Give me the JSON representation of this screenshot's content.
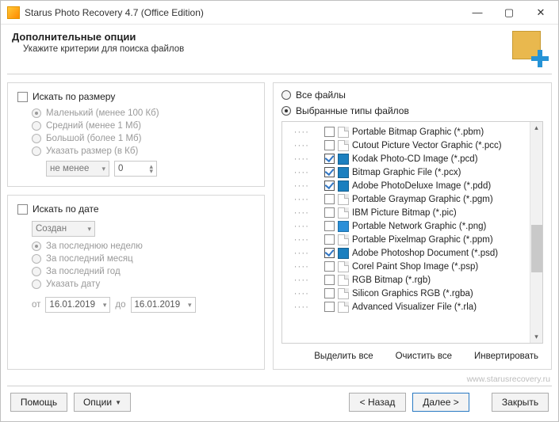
{
  "window": {
    "title": "Starus Photo Recovery 4.7 (Office Edition)"
  },
  "header": {
    "title": "Дополнительные опции",
    "subtitle": "Укажите критерии для поиска файлов"
  },
  "size_panel": {
    "title": "Искать по размеру",
    "opts": [
      "Маленький (менее 100 Кб)",
      "Средний (менее 1 Мб)",
      "Большой (более 1 Мб)",
      "Указать размер (в Кб)"
    ],
    "combo": "не менее",
    "spin": "0"
  },
  "date_panel": {
    "title": "Искать по дате",
    "combo": "Создан",
    "opts": [
      "За последнюю неделю",
      "За последний месяц",
      "За последний год",
      "Указать дату"
    ],
    "from_lbl": "от",
    "to_lbl": "до",
    "from": "16.01.2019",
    "to": "16.01.2019"
  },
  "types_panel": {
    "all_label": "Все файлы",
    "selected_label": "Выбранные типы файлов",
    "items": [
      {
        "checked": false,
        "icon": "doc",
        "label": "Portable Bitmap Graphic (*.pbm)"
      },
      {
        "checked": false,
        "icon": "doc",
        "label": "Cutout Picture Vector Graphic (*.pcc)"
      },
      {
        "checked": true,
        "icon": "ps",
        "label": "Kodak Photo-CD Image (*.pcd)"
      },
      {
        "checked": true,
        "icon": "ps",
        "label": "Bitmap Graphic File (*.pcx)"
      },
      {
        "checked": true,
        "icon": "ps",
        "label": "Adobe PhotoDeluxe Image (*.pdd)"
      },
      {
        "checked": false,
        "icon": "doc",
        "label": "Portable Graymap Graphic (*.pgm)"
      },
      {
        "checked": false,
        "icon": "doc",
        "label": "IBM Picture Bitmap (*.pic)"
      },
      {
        "checked": false,
        "icon": "png",
        "label": "Portable Network Graphic (*.png)"
      },
      {
        "checked": false,
        "icon": "doc",
        "label": "Portable Pixelmap Graphic (*.ppm)"
      },
      {
        "checked": true,
        "icon": "ps",
        "label": "Adobe Photoshop Document (*.psd)"
      },
      {
        "checked": false,
        "icon": "doc",
        "label": "Corel Paint Shop Image (*.psp)"
      },
      {
        "checked": false,
        "icon": "doc",
        "label": "RGB Bitmap (*.rgb)"
      },
      {
        "checked": false,
        "icon": "doc",
        "label": "Silicon Graphics RGB (*.rgba)"
      },
      {
        "checked": false,
        "icon": "doc",
        "label": "Advanced Visualizer File (*.rla)"
      }
    ],
    "links": {
      "select_all": "Выделить все",
      "clear_all": "Очистить все",
      "invert": "Инвертировать"
    }
  },
  "watermark": "www.starusrecovery.ru",
  "footer": {
    "help": "Помощь",
    "options": "Опции",
    "back": "< Назад",
    "next": "Далее >",
    "close": "Закрыть"
  }
}
